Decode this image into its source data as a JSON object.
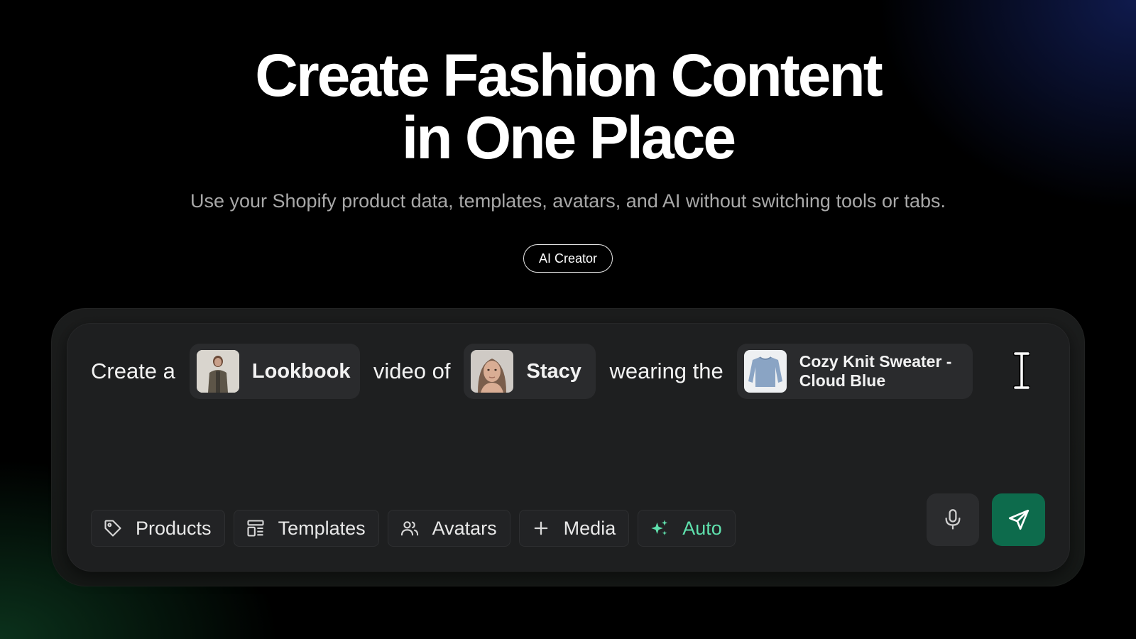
{
  "hero": {
    "title_line1": "Create Fashion Content",
    "title_line2": "in One Place",
    "subtitle": "Use your Shopify product data, templates, avatars, and AI without switching tools or tabs.",
    "badge": "AI Creator"
  },
  "prompt": {
    "word1": "Create a",
    "template_chip": "Lookbook",
    "word2": "video of",
    "avatar_chip": "Stacy",
    "word3": "wearing the",
    "product_chip": "Cozy Knit Sweater - Cloud Blue"
  },
  "toolbar": {
    "products": "Products",
    "templates": "Templates",
    "avatars": "Avatars",
    "media": "Media",
    "auto": "Auto"
  },
  "icons": {
    "products": "tag-icon",
    "templates": "layout-icon",
    "avatars": "users-icon",
    "media": "plus-icon",
    "auto": "sparkles-icon",
    "mic": "microphone-icon",
    "send": "send-icon",
    "cursor": "text-cursor-icon"
  },
  "colors": {
    "accent_green": "#0d6b4c",
    "auto_green": "#5fe0ad",
    "background": "#000000",
    "composer": "#1e1f20"
  }
}
